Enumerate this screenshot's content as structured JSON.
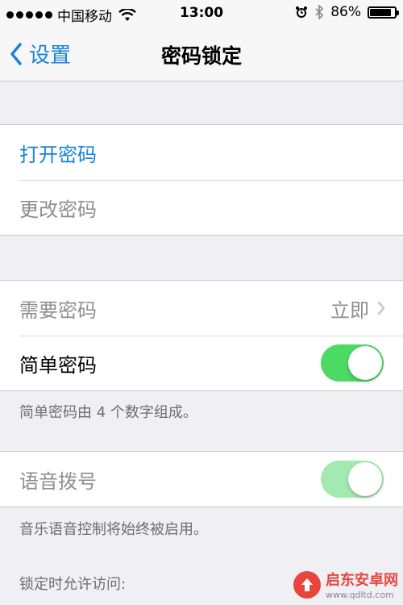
{
  "status_bar": {
    "carrier": "中国移动",
    "time": "13:00",
    "battery_percent": "86%",
    "battery_level": 0.86
  },
  "nav": {
    "back_label": "设置",
    "title": "密码锁定"
  },
  "group1": {
    "items": [
      {
        "label": "打开密码"
      },
      {
        "label": "更改密码"
      }
    ]
  },
  "group2": {
    "require_label": "需要密码",
    "require_value": "立即",
    "simple_label": "简单密码",
    "simple_on": true,
    "footer": "简单密码由 4 个数字组成。"
  },
  "group3": {
    "voice_label": "语音拨号",
    "voice_on": true,
    "footer": "音乐语音控制将始终被启用。"
  },
  "locked_access_header": "锁定时允许访问:",
  "watermark": {
    "title": "启东安卓网",
    "url": "www.qdltd.com"
  },
  "colors": {
    "accent": "#1a82d8",
    "toggle_on": "#4cd964",
    "toggle_disabled": "#a4e9b0"
  }
}
